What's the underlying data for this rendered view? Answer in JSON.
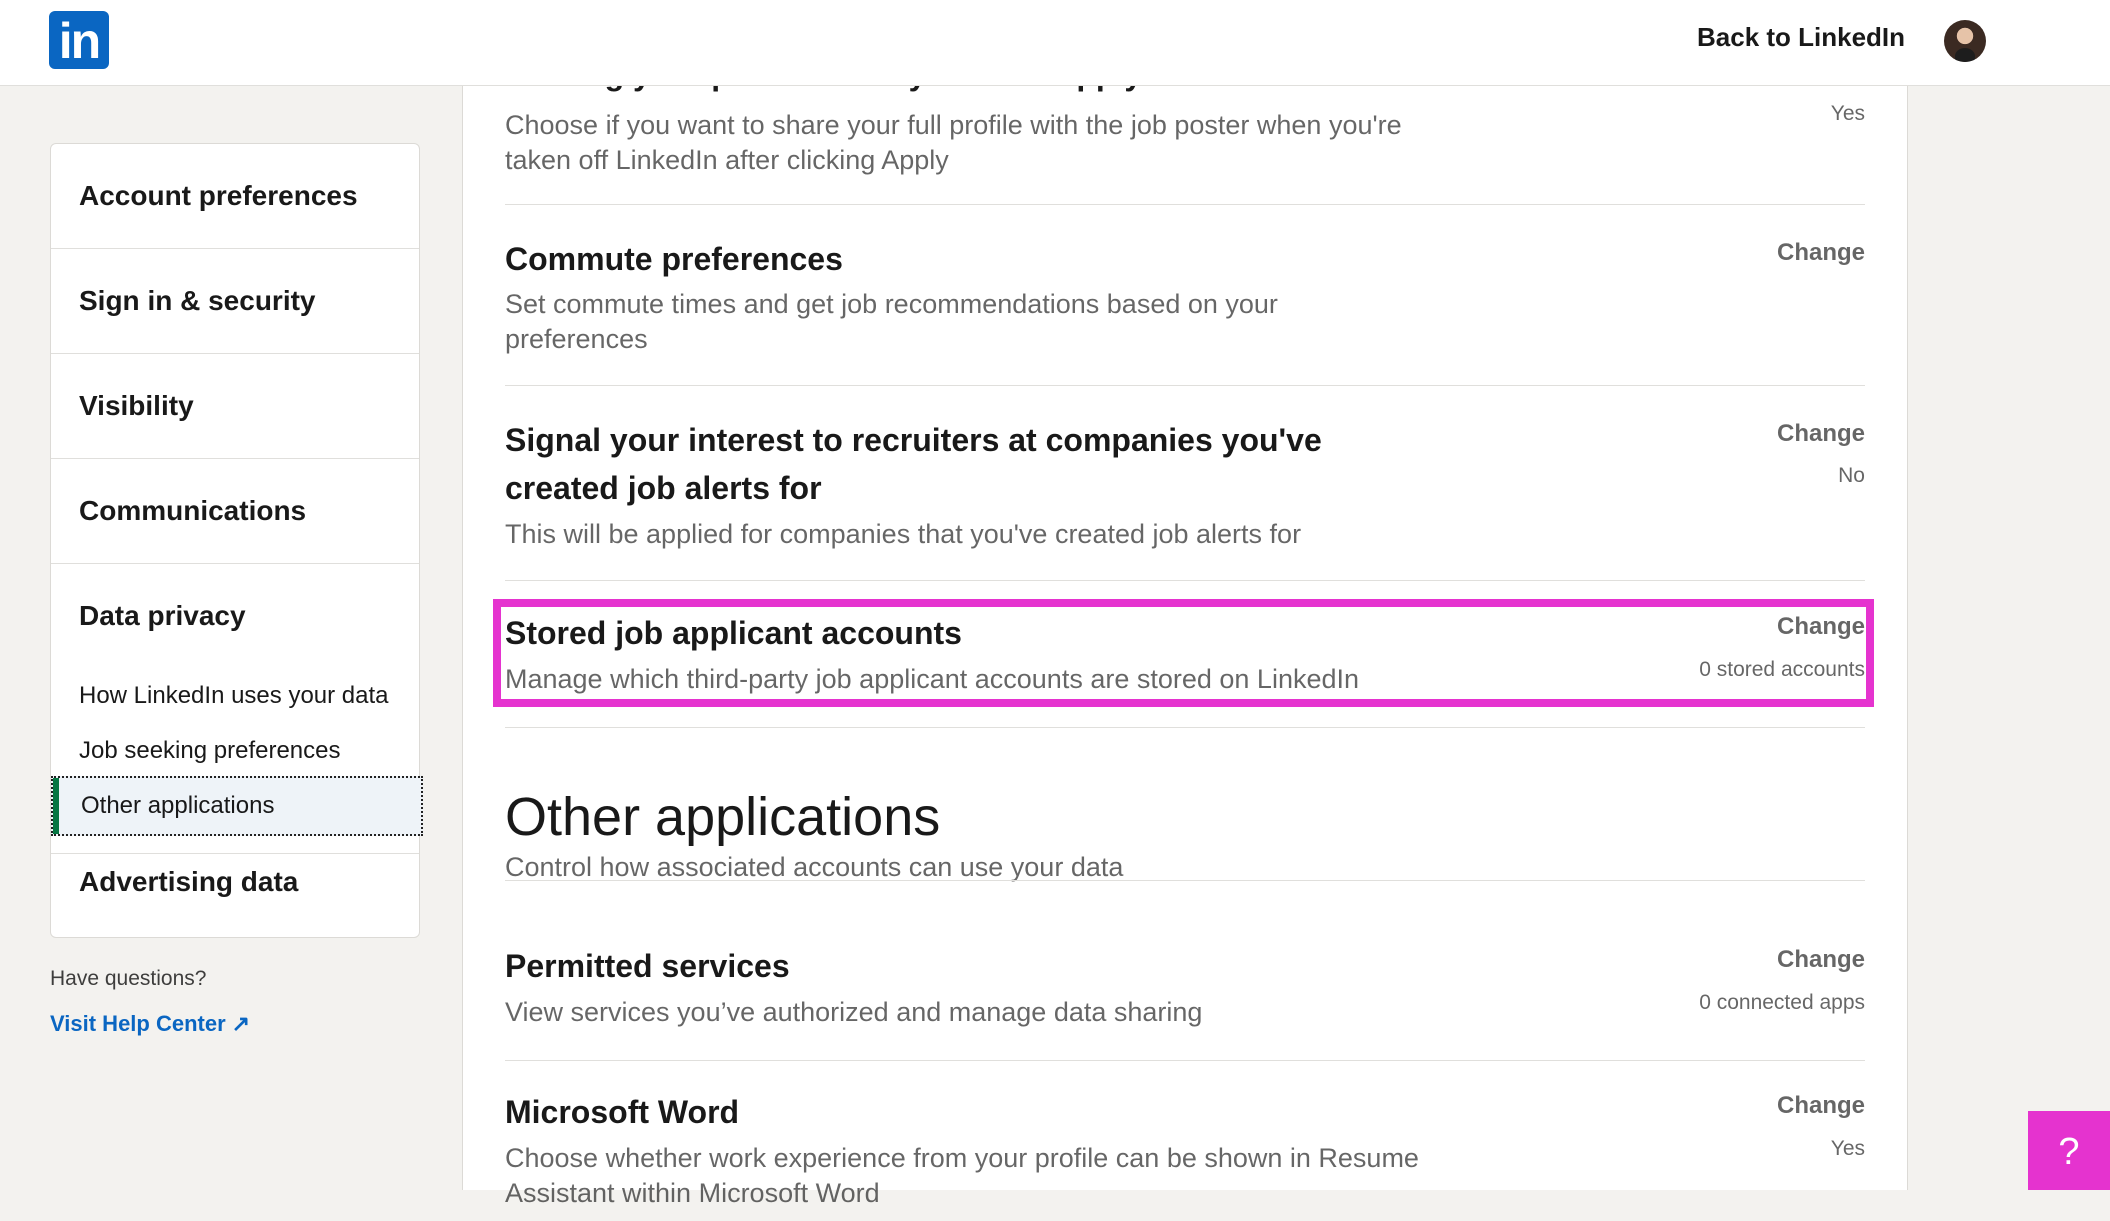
{
  "header": {
    "logo_text": "in",
    "back_link": "Back to LinkedIn"
  },
  "sidebar": {
    "sections": [
      {
        "label": "Account preferences"
      },
      {
        "label": "Sign in & security"
      },
      {
        "label": "Visibility"
      },
      {
        "label": "Communications"
      },
      {
        "label": "Data privacy"
      },
      {
        "label": "Advertising data"
      }
    ],
    "data_privacy_items": [
      {
        "label": "How LinkedIn uses your data"
      },
      {
        "label": "Job seeking preferences"
      },
      {
        "label": "Other applications"
      }
    ],
    "questions": "Have questions?",
    "help_link": "Visit Help Center"
  },
  "main": {
    "rows": [
      {
        "heading": "Sharing your profile when you click Apply",
        "description": "Choose if you want to share your full profile with the job poster when you're taken off LinkedIn after clicking Apply",
        "action": "",
        "value": "Yes"
      },
      {
        "heading": "Commute preferences",
        "description": "Set commute times and get job recommendations based on your preferences",
        "action": "Change",
        "value": ""
      },
      {
        "heading": "Signal your interest to recruiters at companies you've created job alerts for",
        "description": "This will be applied for companies that you've created job alerts for",
        "action": "Change",
        "value": "No"
      },
      {
        "heading": "Stored job applicant accounts",
        "description": "Manage which third-party job applicant accounts are stored on LinkedIn",
        "action": "Change",
        "value": "0 stored accounts"
      }
    ],
    "other_apps": {
      "title": "Other applications",
      "subtitle": "Control how associated accounts can use your data",
      "rows": [
        {
          "heading": "Permitted services",
          "description": "View services you’ve authorized and manage data sharing",
          "action": "Change",
          "value": "0 connected apps"
        },
        {
          "heading": "Microsoft Word",
          "description": "Choose whether work experience from your profile can be shown in Resume Assistant within Microsoft Word",
          "action": "Change",
          "value": "Yes"
        }
      ]
    }
  },
  "help_button": "?",
  "colors": {
    "brand": "#0a66c2",
    "highlight": "#e533cf",
    "active_bar": "#057642"
  }
}
